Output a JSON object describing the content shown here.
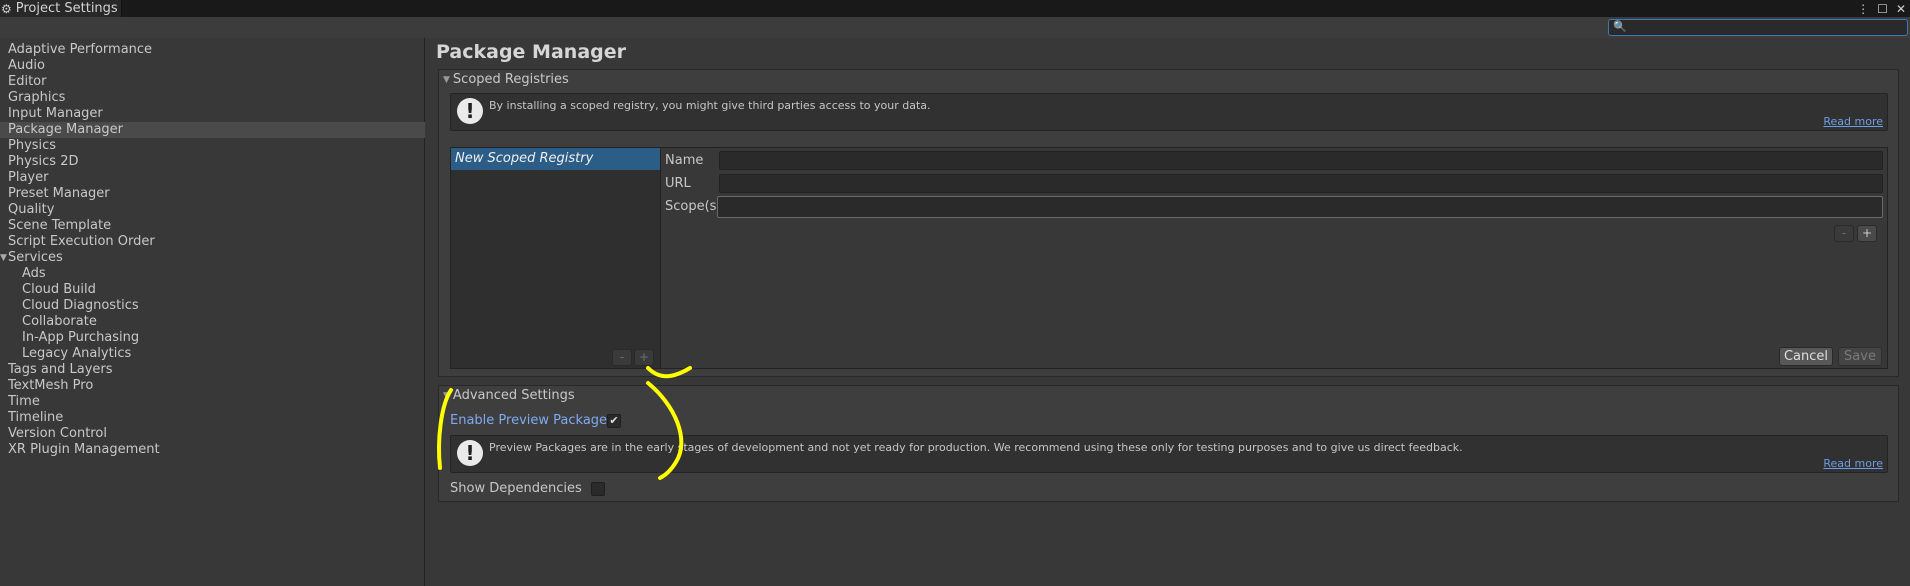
{
  "window": {
    "tab_title": "Project Settings",
    "tab_icon": "gear-icon",
    "controls": [
      "⋮",
      "☐",
      "✕"
    ]
  },
  "search": {
    "placeholder": "",
    "value": ""
  },
  "sidebar": {
    "items": [
      {
        "label": "Adaptive Performance"
      },
      {
        "label": "Audio"
      },
      {
        "label": "Editor"
      },
      {
        "label": "Graphics"
      },
      {
        "label": "Input Manager"
      },
      {
        "label": "Package Manager",
        "selected": true
      },
      {
        "label": "Physics"
      },
      {
        "label": "Physics 2D"
      },
      {
        "label": "Player"
      },
      {
        "label": "Preset Manager"
      },
      {
        "label": "Quality"
      },
      {
        "label": "Scene Template"
      },
      {
        "label": "Script Execution Order"
      },
      {
        "label": "Services",
        "expanded": true
      },
      {
        "label": "Ads",
        "child": true
      },
      {
        "label": "Cloud Build",
        "child": true
      },
      {
        "label": "Cloud Diagnostics",
        "child": true
      },
      {
        "label": "Collaborate",
        "child": true
      },
      {
        "label": "In-App Purchasing",
        "child": true
      },
      {
        "label": "Legacy Analytics",
        "child": true
      },
      {
        "label": "Tags and Layers"
      },
      {
        "label": "TextMesh Pro"
      },
      {
        "label": "Time"
      },
      {
        "label": "Timeline"
      },
      {
        "label": "Version Control"
      },
      {
        "label": "XR Plugin Management"
      }
    ]
  },
  "main": {
    "title": "Package Manager",
    "scoped": {
      "header": "Scoped Registries",
      "help_text": "By installing a scoped registry, you might give third parties access to your data.",
      "read_more": "Read more",
      "registry_item": "New Scoped Registry",
      "name_label": "Name",
      "url_label": "URL",
      "scope_label": "Scope(s)",
      "name_value": "",
      "url_value": "",
      "scope_value": "",
      "minus": "-",
      "plus": "+",
      "cancel": "Cancel",
      "save": "Save"
    },
    "advanced": {
      "header": "Advanced Settings",
      "enable_preview_label": "Enable Preview Packages",
      "enable_preview_checked": true,
      "preview_help_text": "Preview Packages are in the early stages of development and not yet ready for production. We recommend using these only for testing purposes and to give us direct feedback.",
      "read_more": "Read more",
      "show_deps_label": "Show Dependencies",
      "show_deps_checked": false
    }
  },
  "colors": {
    "accent_link": "#6f9ce6",
    "selection_blue": "#2c5d87",
    "annotation_yellow": "#ffff00"
  }
}
